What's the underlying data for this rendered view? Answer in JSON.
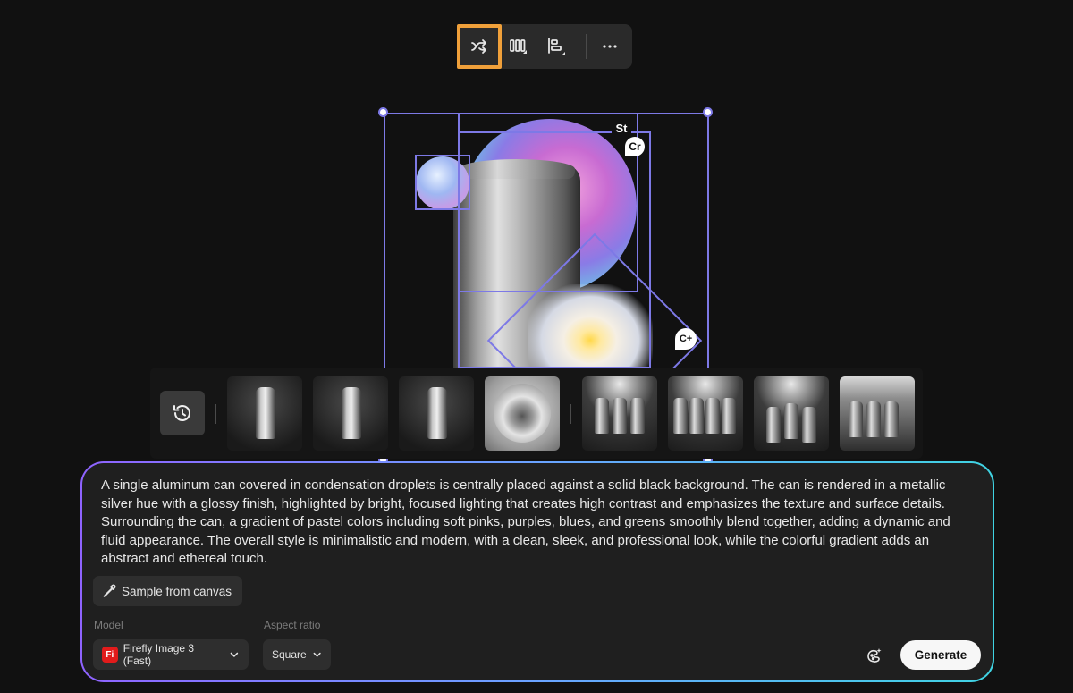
{
  "toolbar": {
    "active_tool": "shuffle-icon",
    "items": [
      "shuffle-icon",
      "distribute-icon",
      "align-icon",
      "more-icon"
    ],
    "active_color": "#f0a03a"
  },
  "canvas": {
    "badges": {
      "stock": "St",
      "creative_cloud": "Cr",
      "context": "C+"
    },
    "selection_color": "#7d79e6"
  },
  "history_strip": {
    "history_icon": "history-icon"
  },
  "prompt": {
    "text": "A single aluminum can covered in condensation droplets is centrally placed against a solid black background. The can is rendered in a metallic silver hue with a glossy finish, highlighted by bright, focused lighting that creates high contrast and emphasizes the texture and surface details. Surrounding the can, a gradient of pastel colors including soft pinks, purples, blues, and greens smoothly blend together, adding a dynamic and fluid appearance. The overall style is minimalistic and modern, with a clean, sleek, and professional look, while the colorful gradient adds an abstract and ethereal touch.",
    "sample_button": "Sample from canvas",
    "model_label": "Model",
    "model_logo": "Fi",
    "model_value": "Firefly Image 3 (Fast)",
    "aspect_label": "Aspect ratio",
    "aspect_value": "Square",
    "generate_button": "Generate",
    "border_gradient": [
      "#8f63ff",
      "#6aa3ff",
      "#3fd3e2"
    ]
  }
}
